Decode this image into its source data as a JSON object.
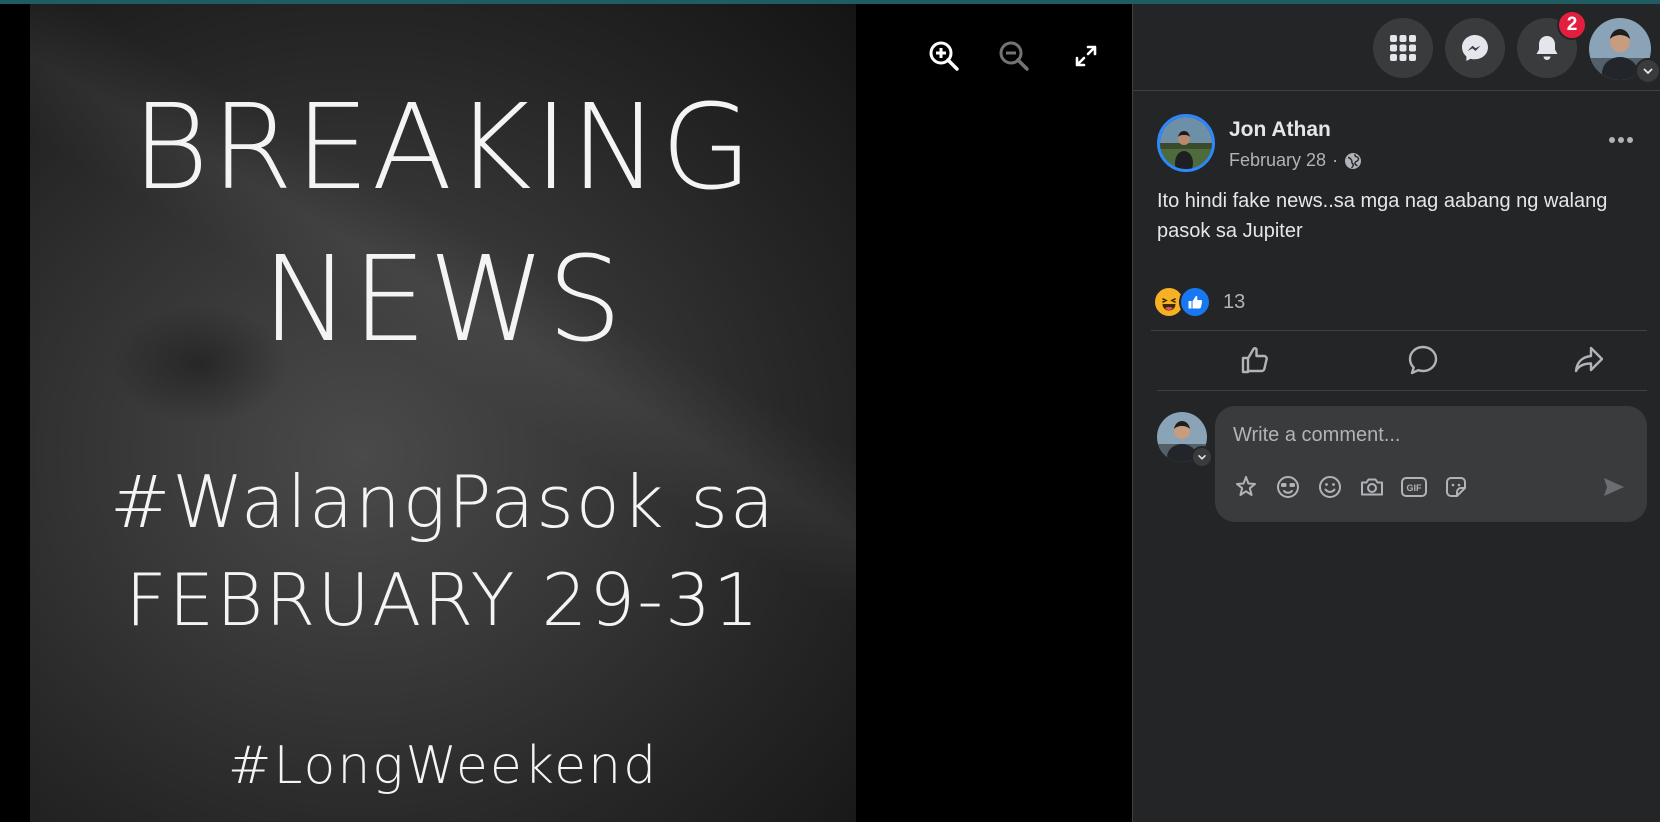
{
  "viewer": {
    "image_lines": [
      "BREAKING",
      "NEWS",
      "#WalangPasok sa",
      "FEBRUARY 29-31",
      "#LongWeekend"
    ],
    "controls": [
      "zoom-in-icon",
      "zoom-out-icon",
      "fullscreen-icon"
    ]
  },
  "header": {
    "notification_count": "2",
    "icons": [
      "menu-grid-icon",
      "messenger-icon",
      "bell-icon",
      "account-avatar"
    ]
  },
  "post": {
    "author": "Jon Athan",
    "date": "February 28",
    "date_separator": "·",
    "privacy_icon": "globe-icon",
    "text": "Ito hindi fake news..sa mga nag aabang ng walang pasok sa Jupiter",
    "reaction_icons": [
      "haha",
      "like"
    ],
    "reaction_count": "13",
    "actions": [
      "like-icon",
      "comment-icon",
      "share-icon"
    ]
  },
  "comment": {
    "placeholder": "Write a comment...",
    "tools": [
      "avatar-sticker-icon",
      "emoji-face-icon",
      "emoji-icon",
      "camera-icon",
      "gif-icon",
      "sticker-icon",
      "send-icon"
    ],
    "gif_label": "GIF"
  },
  "colors": {
    "panel_bg": "#242526",
    "input_bg": "#3a3b3c",
    "text_primary": "#e4e6eb",
    "text_secondary": "#b0b3b8",
    "accent": "#2d88ff",
    "badge": "#e41e3f"
  }
}
